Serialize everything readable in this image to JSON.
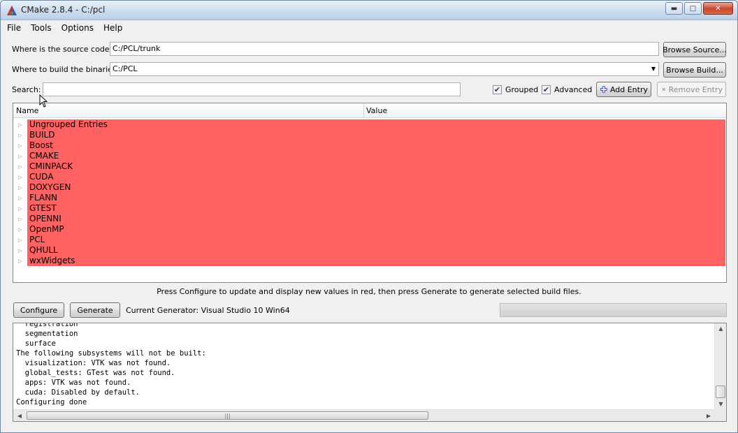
{
  "window": {
    "title": "CMake 2.8.4 - C:/pcl",
    "minimize_glyph": "▬",
    "maximize_glyph": "□",
    "close_glyph": "✕"
  },
  "menu": [
    "File",
    "Tools",
    "Options",
    "Help"
  ],
  "source": {
    "label": "Where is the source code:",
    "value": "C:/PCL/trunk",
    "browse_label": "Browse Source..."
  },
  "build": {
    "label": "Where to build the binaries:",
    "value": "C:/PCL",
    "browse_label": "Browse Build..."
  },
  "search": {
    "label": "Search:",
    "value": ""
  },
  "options": {
    "grouped_label": "Grouped",
    "grouped_checked": true,
    "advanced_label": "Advanced",
    "advanced_checked": true,
    "add_entry_label": "Add Entry",
    "remove_entry_label": "Remove Entry"
  },
  "tree": {
    "columns": [
      "Name",
      "Value"
    ],
    "row_color": "#ff6262",
    "items": [
      "Ungrouped Entries",
      "BUILD",
      "Boost",
      "CMAKE",
      "CMINPACK",
      "CUDA",
      "DOXYGEN",
      "FLANN",
      "GTEST",
      "OPENNI",
      "OpenMP",
      "PCL",
      "QHULL",
      "wxWidgets"
    ]
  },
  "hint": "Press Configure to update and display new values in red, then press Generate to generate selected build files.",
  "actions": {
    "configure_label": "Configure",
    "generate_label": "Generate",
    "generator_text": "Current Generator: Visual Studio 10 Win64"
  },
  "output": {
    "lines": [
      "  registration",
      "  segmentation",
      "  surface",
      "The following subsystems will not be built:",
      "  visualization: VTK was not found.",
      "  global_tests: GTest was not found.",
      "  apps: VTK was not found.",
      "  cuda: Disabled by default.",
      "Configuring done"
    ]
  },
  "icons": {
    "app": "cmake-triangle-icon",
    "add": "plus-icon",
    "remove": "x-icon",
    "expand": "triangle-right-icon"
  }
}
